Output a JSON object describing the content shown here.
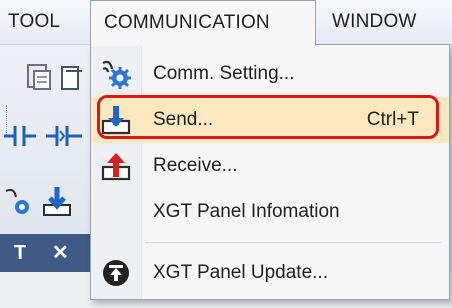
{
  "menubar": {
    "tool": "TOOL",
    "communication": "COMMUNICATION",
    "window": "WINDOW"
  },
  "dropdown": {
    "items": [
      {
        "label": "Comm. Setting...",
        "icon": "comm-setting-icon"
      },
      {
        "label": "Send...",
        "shortcut": "Ctrl+T",
        "icon": "send-icon",
        "highlighted": true
      },
      {
        "label": "Receive...",
        "icon": "receive-icon"
      },
      {
        "label": "XGT Panel Infomation",
        "icon": ""
      },
      {
        "label": "XGT Panel Update...",
        "icon": "panel-update-icon"
      }
    ]
  },
  "panel": {
    "pin": "Т",
    "close": "✕"
  },
  "colors": {
    "highlight_bg": "#fde9c0",
    "highlight_border": "#e01515",
    "send_arrow": "#1e66c8",
    "receive_arrow": "#d81e1e",
    "panel_caption": "#3f5a84"
  }
}
